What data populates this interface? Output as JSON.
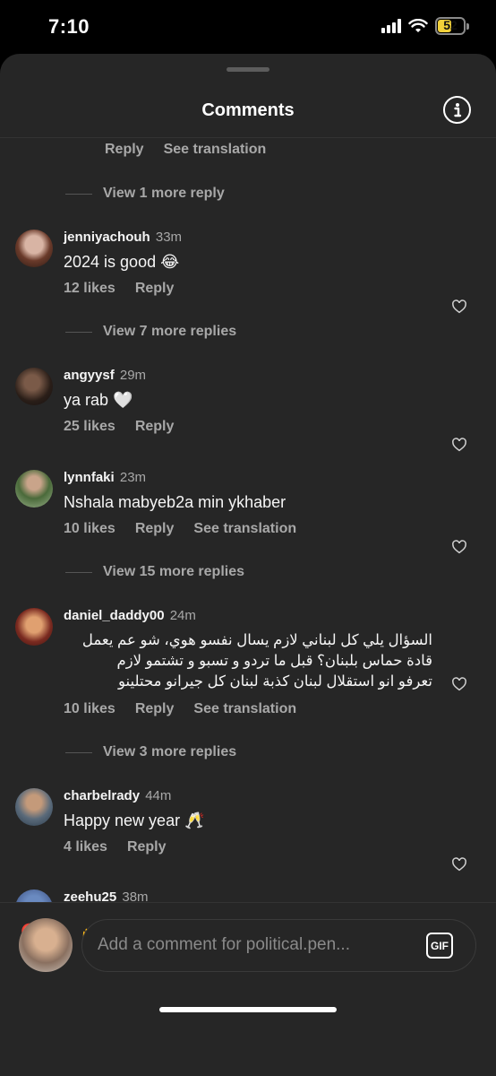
{
  "status_bar": {
    "time": "7:10",
    "battery": "52"
  },
  "sheet": {
    "title": "Comments"
  },
  "top_partial": {
    "reply": "Reply",
    "see_translation": "See translation"
  },
  "view_replies": [
    "View 1 more reply",
    "View 7 more replies",
    "View 15 more replies",
    "View 3 more replies"
  ],
  "comments": [
    {
      "username": "jenniyachouh",
      "time": "33m",
      "text": "2024 is good 😂",
      "likes": "12 likes",
      "reply": "Reply"
    },
    {
      "username": "angyysf",
      "time": "29m",
      "text": "ya rab 🤍",
      "likes": "25 likes",
      "reply": "Reply"
    },
    {
      "username": "lynnfaki",
      "time": "23m",
      "text": "Nshala mabyeb2a min ykhaber",
      "likes": "10 likes",
      "reply": "Reply",
      "see_translation": "See translation"
    },
    {
      "username": "daniel_daddy00",
      "time": "24m",
      "text_lines": [
        "السؤال يلي كل لبناني لازم يسال نفسو هوي، شو عم يعمل",
        "قادة حماس بلبنان؟ قبل ما تردو و تسبو و تشتمو لازم",
        "تعرفو انو استقلال لبنان كذبة لبنان كل جيرانو محتلينو"
      ],
      "likes": "10 likes",
      "reply": "Reply",
      "see_translation": "See translation"
    },
    {
      "username": "charbelrady",
      "time": "44m",
      "text": "Happy new year 🥂",
      "likes": "4 likes",
      "reply": "Reply"
    },
    {
      "username": "zeehu25",
      "time": "38m"
    }
  ],
  "reactions": [
    "❤️",
    "🙌",
    "🔥",
    "👏",
    "😢",
    "😍",
    "😮",
    "😂"
  ],
  "composer": {
    "placeholder": "Add a comment for political.pen...",
    "gif_label": "GIF"
  },
  "icons": {
    "info": "info-icon",
    "heart": "heart-outline-icon",
    "wifi": "wifi-icon",
    "signal": "cellular-signal-icon",
    "battery": "battery-icon",
    "gif": "gif-icon"
  },
  "colors": {
    "sheet_bg": "#262626",
    "secondary_text": "#a8a8a8",
    "battery_fill": "#f2d13a"
  }
}
